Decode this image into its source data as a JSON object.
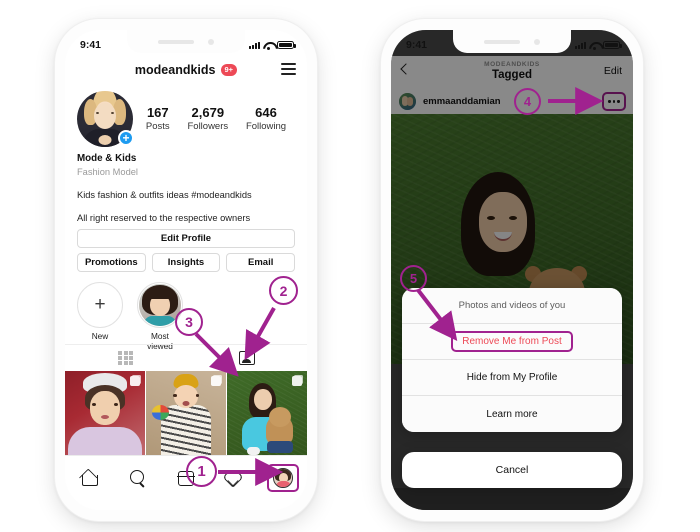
{
  "meta": {
    "accent_purple": "#a0228f",
    "ig_red": "#ed4956",
    "blue": "#1d9bf0"
  },
  "left_phone": {
    "status_bar": {
      "time": "9:41",
      "signal_icon": "cellular-signal-icon",
      "wifi_icon": "wifi-icon",
      "battery_icon": "battery-icon"
    },
    "header": {
      "username": "modeandkids",
      "badge": "9+",
      "menu_icon": "hamburger-menu-icon"
    },
    "profile": {
      "avatar": "profile-avatar",
      "add_story_icon": "plus-icon",
      "stats": [
        {
          "num": "167",
          "label": "Posts"
        },
        {
          "num": "2,679",
          "label": "Followers"
        },
        {
          "num": "646",
          "label": "Following"
        }
      ],
      "display_name": "Mode & Kids",
      "category": "Fashion Model",
      "bio_line1": "Kids fashion & outfits ideas #modeandkids",
      "bio_line2": "All right reserved to the respective owners"
    },
    "buttons": {
      "edit_profile": "Edit Profile",
      "promotions": "Promotions",
      "insights": "Insights",
      "email": "Email"
    },
    "highlights": [
      {
        "label": "New",
        "icon": "plus-icon"
      },
      {
        "label": "Most viewed",
        "icon": "highlight-cover"
      }
    ],
    "tabs": [
      {
        "name": "grid-tab",
        "icon": "grid-icon"
      },
      {
        "name": "tagged-tab",
        "icon": "tagged-person-icon"
      }
    ],
    "grid_photos": [
      {
        "name": "photo-1",
        "multi_icon": "multi-post-icon"
      },
      {
        "name": "photo-2",
        "multi_icon": "multi-post-icon"
      },
      {
        "name": "photo-3",
        "multi_icon": "multi-post-icon"
      }
    ],
    "tabbar": [
      {
        "name": "home-tab",
        "icon": "home-icon"
      },
      {
        "name": "search-tab",
        "icon": "search-icon"
      },
      {
        "name": "reels-tab",
        "icon": "reels-icon"
      },
      {
        "name": "activity-tab",
        "icon": "heart-icon"
      },
      {
        "name": "profile-tab",
        "icon": "profile-avatar-icon"
      }
    ]
  },
  "right_phone": {
    "status_bar": {
      "time": "9:41",
      "signal_icon": "cellular-signal-icon",
      "wifi_icon": "wifi-icon",
      "battery_icon": "battery-icon"
    },
    "nav": {
      "back_icon": "back-chevron-icon",
      "overline": "MODEANDKIDS",
      "title": "Tagged",
      "edit": "Edit"
    },
    "post": {
      "avatar": "post-author-avatar",
      "username": "emmaanddamian",
      "more_icon": "more-options-icon"
    },
    "action_sheet": {
      "title": "Photos and videos of you",
      "options": [
        "Remove Me from Post",
        "Hide from My Profile",
        "Learn more"
      ],
      "cancel": "Cancel"
    }
  },
  "annotations": [
    {
      "id": "1",
      "target": "profile-tab"
    },
    {
      "id": "2",
      "target": "tagged-tab"
    },
    {
      "id": "3",
      "target": "tagged-post-thumbnail"
    },
    {
      "id": "4",
      "target": "more-options-icon"
    },
    {
      "id": "5",
      "target": "remove-me-from-post"
    }
  ]
}
